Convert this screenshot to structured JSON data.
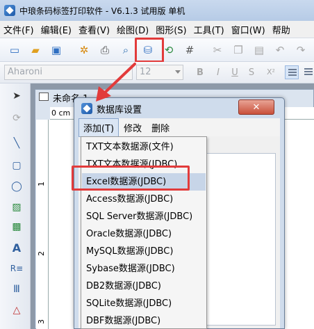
{
  "app": {
    "title": "中琅条码标签打印软件 - V6.1.3 试用版 单机"
  },
  "menubar": {
    "items": [
      "文件(F)",
      "编辑(E)",
      "查看(V)",
      "绘图(D)",
      "图形(S)",
      "工具(T)",
      "窗口(W)",
      "帮助"
    ]
  },
  "fontbar": {
    "font_name": "Aharoni",
    "font_size": "12",
    "bold": "B",
    "italic": "I",
    "underline": "U",
    "strike": "S",
    "superscript": "X²"
  },
  "document": {
    "title": "未命名 1",
    "ruler_zero": "0 cm",
    "ruler_left": [
      "1",
      "2",
      "3"
    ]
  },
  "dialog": {
    "title": "数据库设置",
    "menus": [
      "添加(T)",
      "修改",
      "删除"
    ]
  },
  "dropdown": {
    "items": [
      "TXT文本数据源(文件)",
      "TXT文本数据源(JDBC)",
      "Excel数据源(JDBC)",
      "Access数据源(JDBC)",
      "SQL Server数据源(JDBC)",
      "Oracle数据源(JDBC)",
      "MySQL数据源(JDBC)",
      "Sybase数据源(JDBC)",
      "DB2数据源(JDBC)",
      "SQLite数据源(JDBC)",
      "DBF数据源(JDBC)"
    ],
    "highlighted_index": 2
  },
  "colors": {
    "highlight_red": "#e23b3b"
  }
}
